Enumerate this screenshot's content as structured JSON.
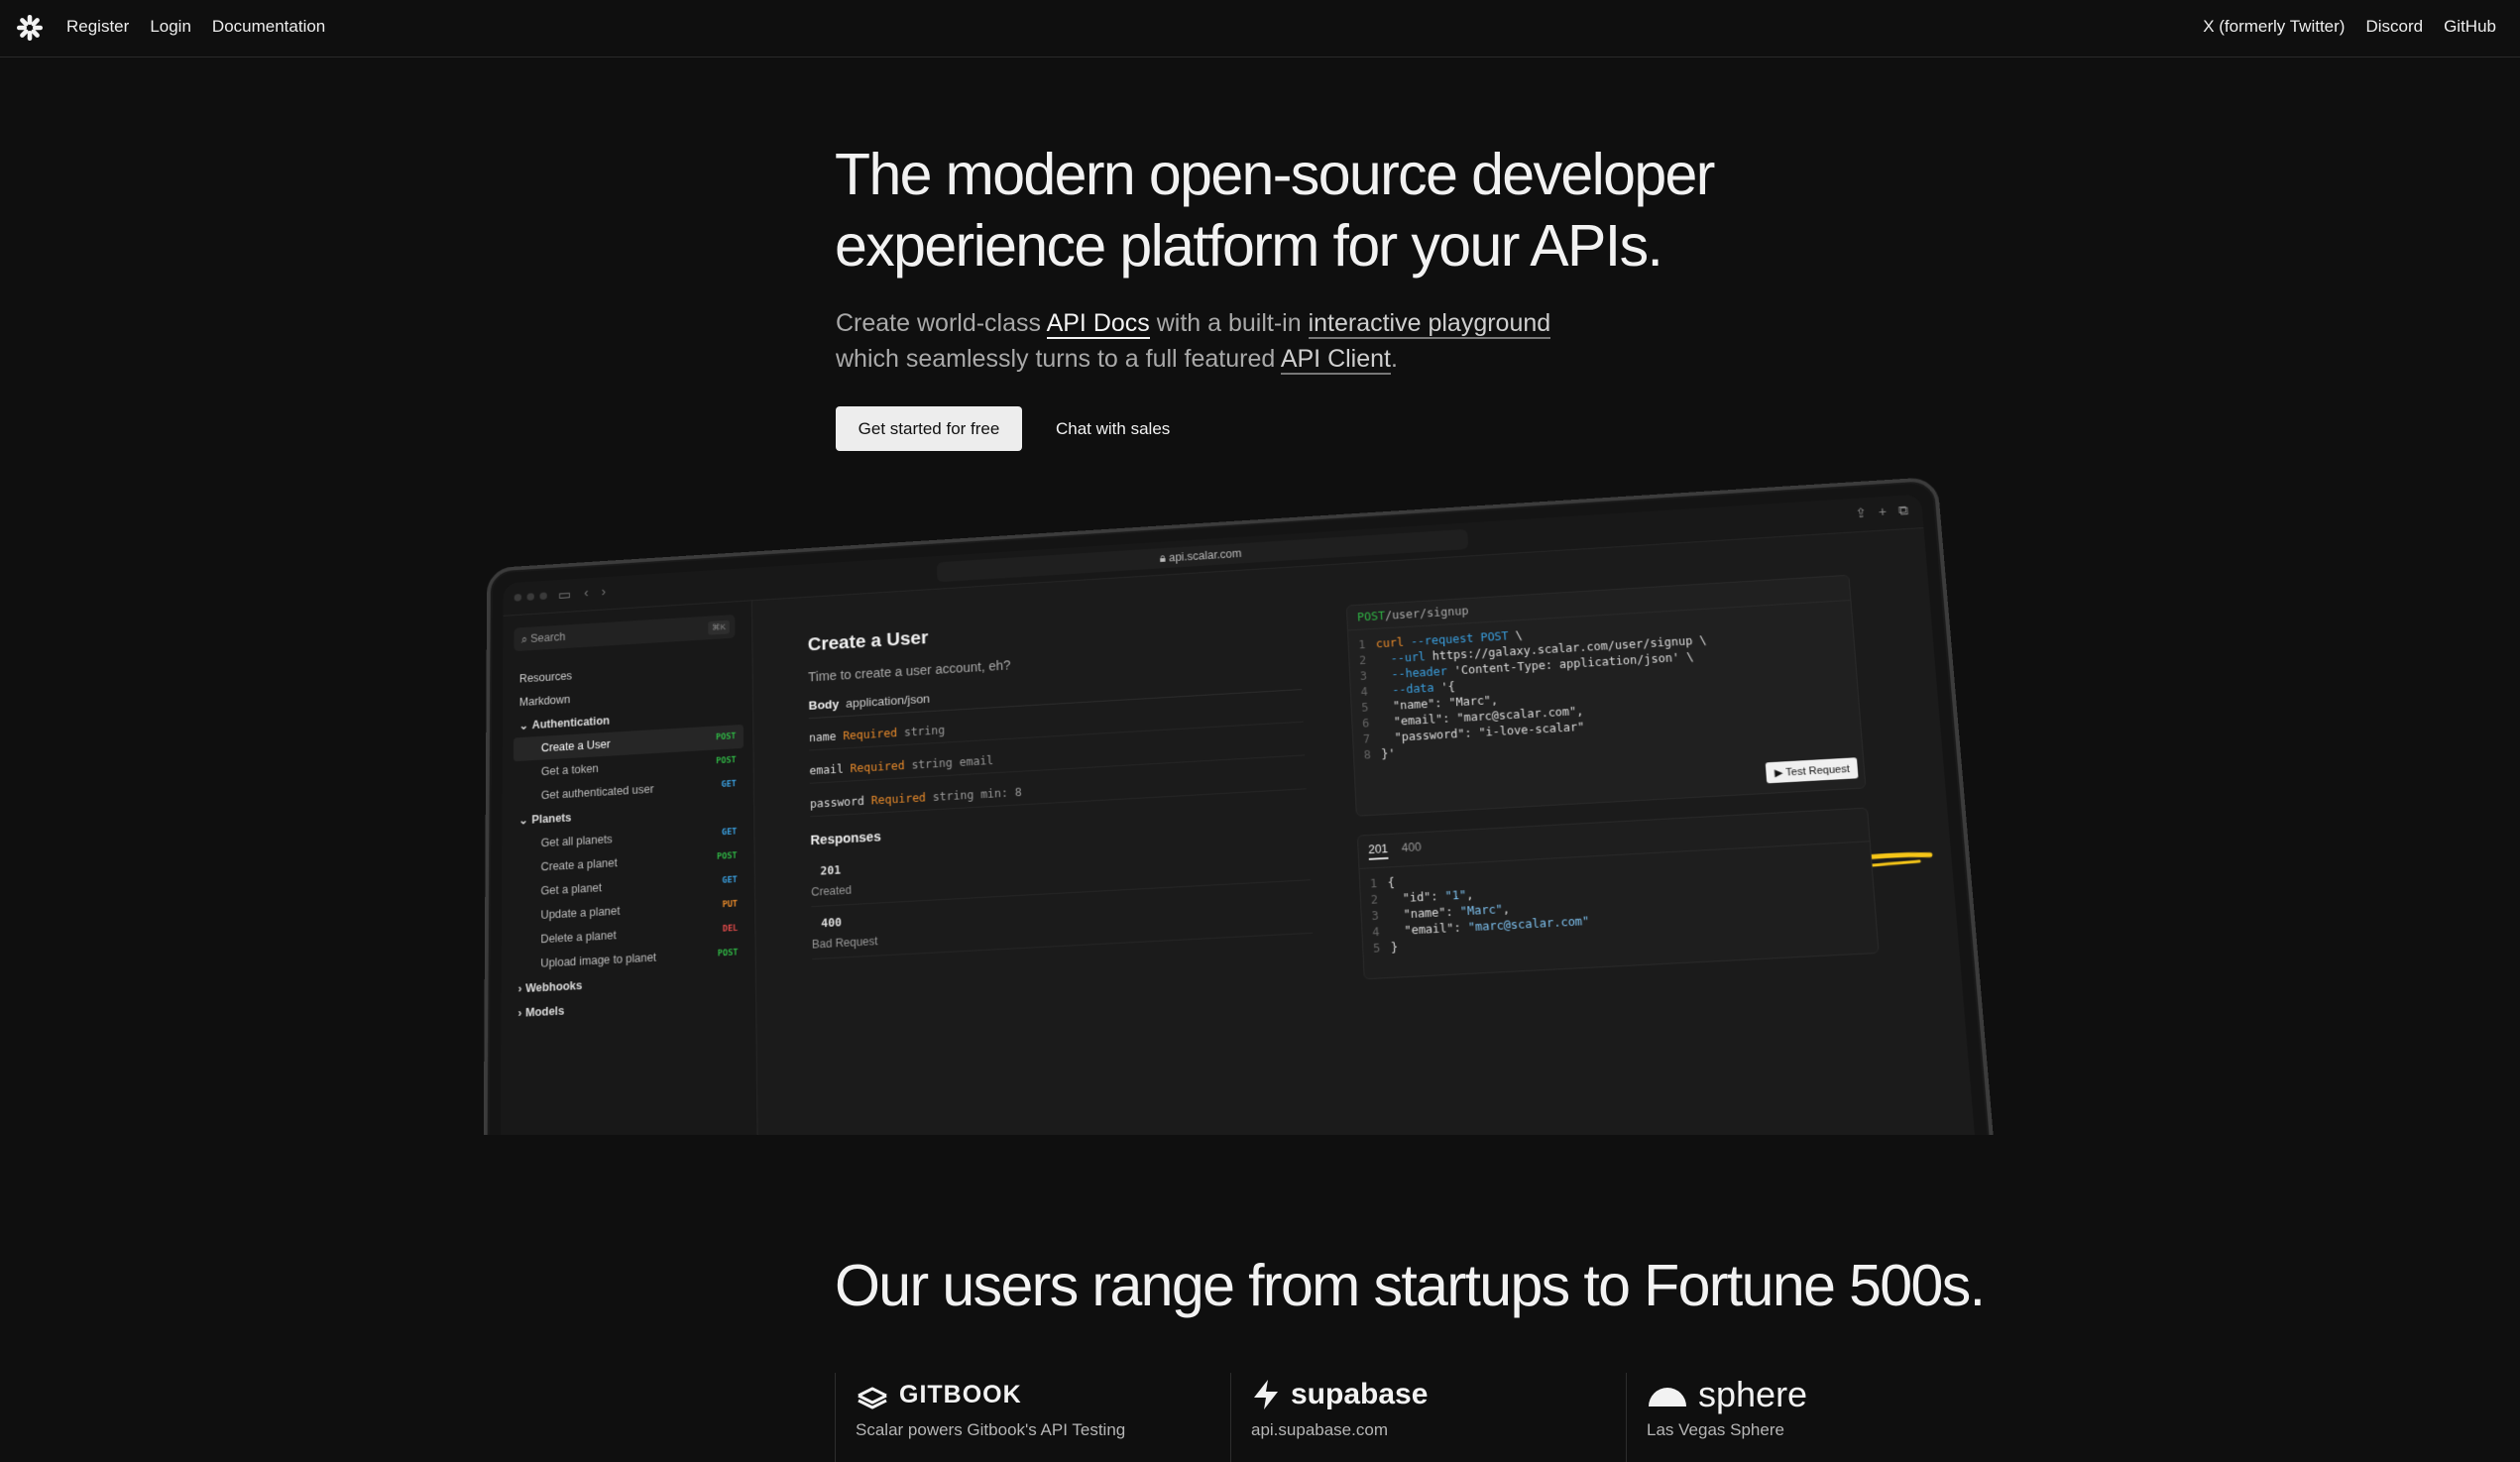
{
  "nav": {
    "left": [
      "Register",
      "Login",
      "Documentation"
    ],
    "right": [
      "X (formerly Twitter)",
      "Discord",
      "GitHub"
    ]
  },
  "hero": {
    "title_line1": "The modern open-source developer",
    "title_line2": "experience platform for your APIs.",
    "sub_1": "Create world-class ",
    "sub_link1": "API Docs",
    "sub_2": " with a built-in ",
    "sub_link2": "interactive playground",
    "sub_3": "which seamlessly turns to a full featured ",
    "sub_link3": "API Client",
    "sub_4": ".",
    "primary_button": "Get started for free",
    "secondary_button": "Chat with sales"
  },
  "mock": {
    "url": "api.scalar.com",
    "search_placeholder": "Search",
    "search_shortcut": "⌘K",
    "sidebar": [
      {
        "label": "Resources",
        "type": "top"
      },
      {
        "label": "Markdown",
        "type": "top"
      },
      {
        "label": "Authentication",
        "type": "group"
      },
      {
        "label": "Create a User",
        "type": "child",
        "method": "POST",
        "active": true
      },
      {
        "label": "Get a token",
        "type": "child",
        "method": "POST"
      },
      {
        "label": "Get authenticated user",
        "type": "child",
        "method": "GET"
      },
      {
        "label": "Planets",
        "type": "group"
      },
      {
        "label": "Get all planets",
        "type": "child",
        "method": "GET"
      },
      {
        "label": "Create a planet",
        "type": "child",
        "method": "POST"
      },
      {
        "label": "Get a planet",
        "type": "child",
        "method": "GET"
      },
      {
        "label": "Update a planet",
        "type": "child",
        "method": "PUT"
      },
      {
        "label": "Delete a planet",
        "type": "child",
        "method": "DEL"
      },
      {
        "label": "Upload image to planet",
        "type": "child",
        "method": "POST"
      },
      {
        "label": "Webhooks",
        "type": "group-collapsed"
      },
      {
        "label": "Models",
        "type": "group-collapsed"
      }
    ],
    "doc": {
      "title": "Create a User",
      "lead": "Time to create a user account, eh?",
      "body_label": "Body",
      "body_type": "application/json",
      "params": [
        {
          "name": "name",
          "req": "Required",
          "type": "string"
        },
        {
          "name": "email",
          "req": "Required",
          "type": "string email"
        },
        {
          "name": "password",
          "req": "Required",
          "type": "string min: 8"
        }
      ],
      "responses_label": "Responses",
      "responses": [
        {
          "code": "201",
          "desc": "Created"
        },
        {
          "code": "400",
          "desc": "Bad Request"
        }
      ]
    },
    "request": {
      "method": "POST",
      "path": "/user/signup",
      "test_button": "▶ Test Request"
    },
    "response_tabs": [
      "201",
      "400"
    ]
  },
  "users": {
    "title": "Our users range from startups to Fortune 500s.",
    "logos": [
      {
        "brand": "GITBOOK",
        "caption": "Scalar powers Gitbook's API Testing"
      },
      {
        "brand": "supabase",
        "caption": "api.supabase.com"
      },
      {
        "brand": "sphere",
        "caption": "Las Vegas Sphere"
      }
    ]
  }
}
